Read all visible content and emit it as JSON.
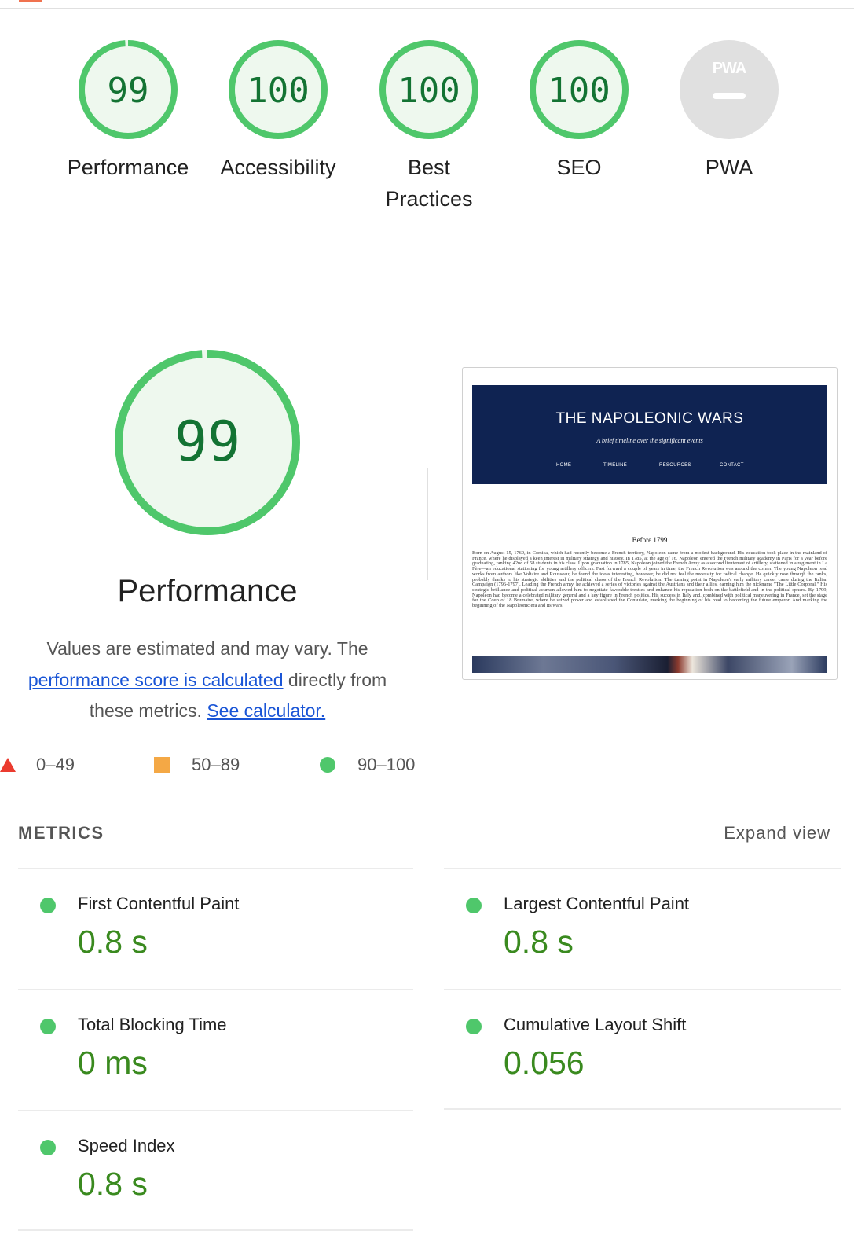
{
  "gauges": [
    {
      "score": "99",
      "label": "Performance",
      "fraction": 0.99
    },
    {
      "score": "100",
      "label": "Accessibility",
      "fraction": 1.0
    },
    {
      "score": "100",
      "label_lines": [
        "Best",
        "Practices"
      ],
      "fraction": 1.0
    },
    {
      "score": "100",
      "label": "SEO",
      "fraction": 1.0
    },
    {
      "badge": "PWA",
      "label": "PWA"
    }
  ],
  "performance": {
    "score": "99",
    "fraction": 0.99,
    "title": "Performance",
    "desc_before": "Values are estimated and may vary. The ",
    "desc_link1": "performance score is calculated",
    "desc_middle": " directly from these metrics. ",
    "desc_link2": "See calculator."
  },
  "legend": [
    {
      "range": "0–49",
      "shape": "triangle",
      "color": "#eb3b2f"
    },
    {
      "range": "50–89",
      "shape": "square",
      "color": "#f4a845"
    },
    {
      "range": "90–100",
      "shape": "circle",
      "color": "#4fc76b"
    }
  ],
  "screenshot": {
    "title": "THE NAPOLEONIC WARS",
    "subtitle": "A brief timeline over the significant events",
    "nav": [
      "HOME",
      "TIMELINE",
      "RESOURCES",
      "CONTACT"
    ],
    "heading": "Before 1799",
    "body": "Born on August 15, 1769, in Corsica, which had recently become a French territory, Napoleon came from a modest background. His education took place in the mainland of France, where he displayed a keen interest in military strategy and history. In 1785, at the age of 16, Napoleon entered the French military academy in Paris for a year before graduating, ranking 42nd of 58 students in his class. Upon graduation in 1785, Napoleon joined the French Army as a second lieutenant of artillery, stationed in a regiment in La Fère—an educational stationing for young artillery officers. Fast forward a couple of years in time, the French Revolution was around the corner. The young Napoleon read works from authors like Voltaire and Rousseau; he found the ideas interesting, however, he did not feel the necessity for radical change. He quickly rose through the ranks, probably thanks to his strategic abilities and the political chaos of the French Revolution. The turning point in Napoleon's early military career came during the Italian Campaign (1796-1797). Leading the French army, he achieved a series of victories against the Austrians and their allies, earning him the nickname \"The Little Corporal.\" His strategic brilliance and political acumen allowed him to negotiate favorable treaties and enhance his reputation both on the battlefield and in the political sphere. By 1799, Napoleon had become a celebrated military general and a key figure in French politics. His success in Italy and, combined with political maneuvering in France, set the stage for the Coup of 18 Brumaire, where he seized power and established the Consulate, marking the beginning of his road to becoming the future emperor. And marking the beginning of the Napoleonic era and its wars."
  },
  "metrics": {
    "heading": "METRICS",
    "expand": "Expand view",
    "items": [
      {
        "title": "First Contentful Paint",
        "value": "0.8 s"
      },
      {
        "title": "Largest Contentful Paint",
        "value": "0.8 s"
      },
      {
        "title": "Total Blocking Time",
        "value": "0 ms"
      },
      {
        "title": "Cumulative Layout Shift",
        "value": "0.056"
      },
      {
        "title": "Speed Index",
        "value": "0.8 s"
      }
    ]
  },
  "colors": {
    "pass": "#4fc76b",
    "pass_text": "#137333",
    "pass_fill": "#eef8ee",
    "pwa_gray": "#e0e0e0"
  }
}
